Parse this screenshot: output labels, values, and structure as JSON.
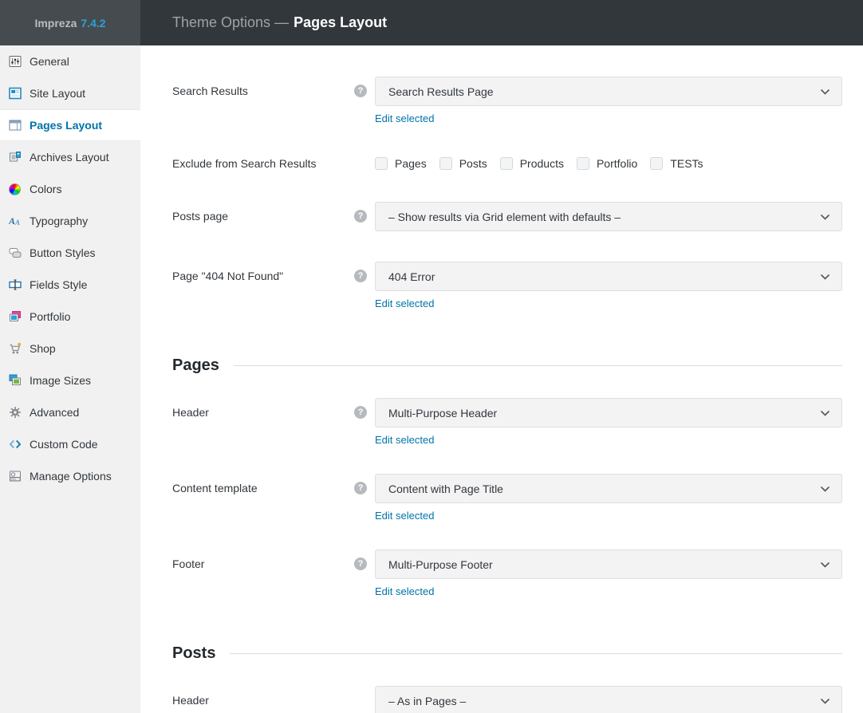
{
  "app": {
    "name": "Impreza",
    "version": "7.4.2"
  },
  "top_bar": {
    "prefix": "Theme Options —",
    "current": "Pages Layout"
  },
  "theme": {
    "accent": "#0073aa",
    "top_bar_bg": "#32373c",
    "sidebar_brand_bg": "#464b50",
    "sidebar_bg": "#f1f1f1",
    "version_color": "#29a3d9",
    "link_color": "#0073aa",
    "select_bg": "#f3f3f4"
  },
  "sidebar": {
    "items": [
      {
        "label": "General",
        "icon": "sliders-icon",
        "active": false
      },
      {
        "label": "Site Layout",
        "icon": "site-layout-icon",
        "active": false
      },
      {
        "label": "Pages Layout",
        "icon": "pages-layout-icon",
        "active": true
      },
      {
        "label": "Archives Layout",
        "icon": "archives-layout-icon",
        "active": false
      },
      {
        "label": "Colors",
        "icon": "color-wheel-icon",
        "active": false
      },
      {
        "label": "Typography",
        "icon": "typography-icon",
        "active": false
      },
      {
        "label": "Button Styles",
        "icon": "button-styles-icon",
        "active": false
      },
      {
        "label": "Fields Style",
        "icon": "fields-style-icon",
        "active": false
      },
      {
        "label": "Portfolio",
        "icon": "portfolio-icon",
        "active": false
      },
      {
        "label": "Shop",
        "icon": "cart-icon",
        "active": false
      },
      {
        "label": "Image Sizes",
        "icon": "image-sizes-icon",
        "active": false
      },
      {
        "label": "Advanced",
        "icon": "gear-icon",
        "active": false
      },
      {
        "label": "Custom Code",
        "icon": "code-icon",
        "active": false
      },
      {
        "label": "Manage Options",
        "icon": "archive-icon",
        "active": false
      }
    ]
  },
  "content": {
    "edit_link": "Edit selected",
    "search_results": {
      "label": "Search Results",
      "value": "Search Results Page"
    },
    "exclude": {
      "label": "Exclude from Search Results",
      "options": [
        "Pages",
        "Posts",
        "Products",
        "Portfolio",
        "TESTs"
      ]
    },
    "posts_page": {
      "label": "Posts page",
      "value": "– Show results via Grid element with defaults –"
    },
    "page_404": {
      "label": "Page \"404 Not Found\"",
      "value": "404 Error"
    },
    "pages_section": {
      "title": "Pages",
      "header": {
        "label": "Header",
        "value": "Multi-Purpose Header"
      },
      "content_template": {
        "label": "Content template",
        "value": "Content with Page Title"
      },
      "footer": {
        "label": "Footer",
        "value": "Multi-Purpose Footer"
      }
    },
    "posts_section": {
      "title": "Posts",
      "header": {
        "label": "Header",
        "value": "– As in Pages –"
      }
    }
  }
}
